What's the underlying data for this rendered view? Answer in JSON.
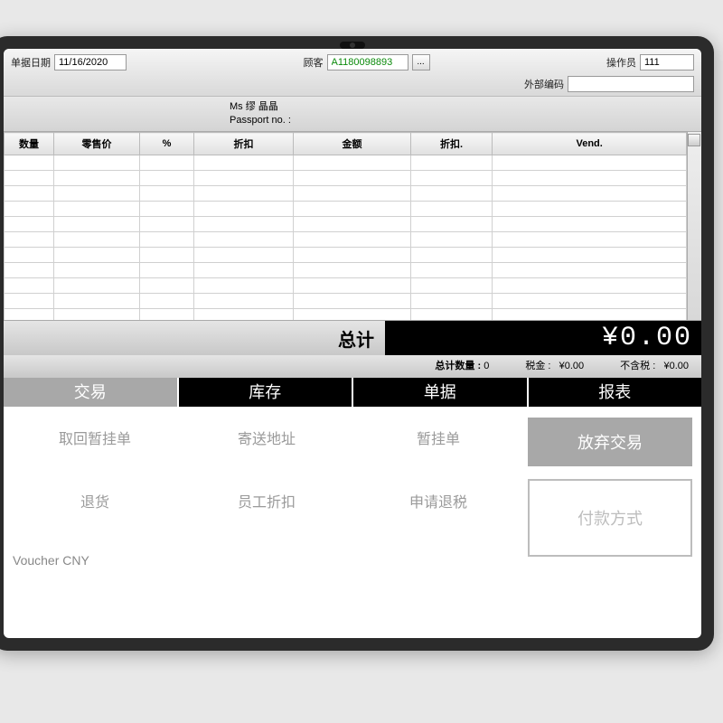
{
  "header": {
    "date_label": "单据日期",
    "date_value": "11/16/2020",
    "customer_label": "顾客",
    "customer_value": "A1180098893",
    "operator_label": "操作员",
    "operator_value": "111",
    "ext_code_label": "外部编码",
    "ext_code_value": "",
    "lookup_btn": "..."
  },
  "customer_info": {
    "name_line": "Ms 缪 晶晶",
    "passport_line": "Passport no. :"
  },
  "grid": {
    "columns": [
      "数量",
      "零售价",
      "%",
      "折扣",
      "金额",
      "折扣.",
      "Vend."
    ]
  },
  "totals": {
    "label": "总计",
    "value": "¥0.00",
    "qty_label": "总计数量 :",
    "qty_value": "0",
    "tax_label": "税金 :",
    "tax_value": "¥0.00",
    "excl_label": "不含税 :",
    "excl_value": "¥0.00"
  },
  "tabs": [
    "交易",
    "库存",
    "单据",
    "报表"
  ],
  "actions": {
    "col1": [
      "取回暂挂单",
      "退货",
      "Voucher CNY"
    ],
    "col2": [
      "寄送地址",
      "员工折扣"
    ],
    "col3": [
      "暂挂单",
      "申请退税"
    ],
    "abandon": "放弃交易",
    "payment": "付款方式"
  }
}
